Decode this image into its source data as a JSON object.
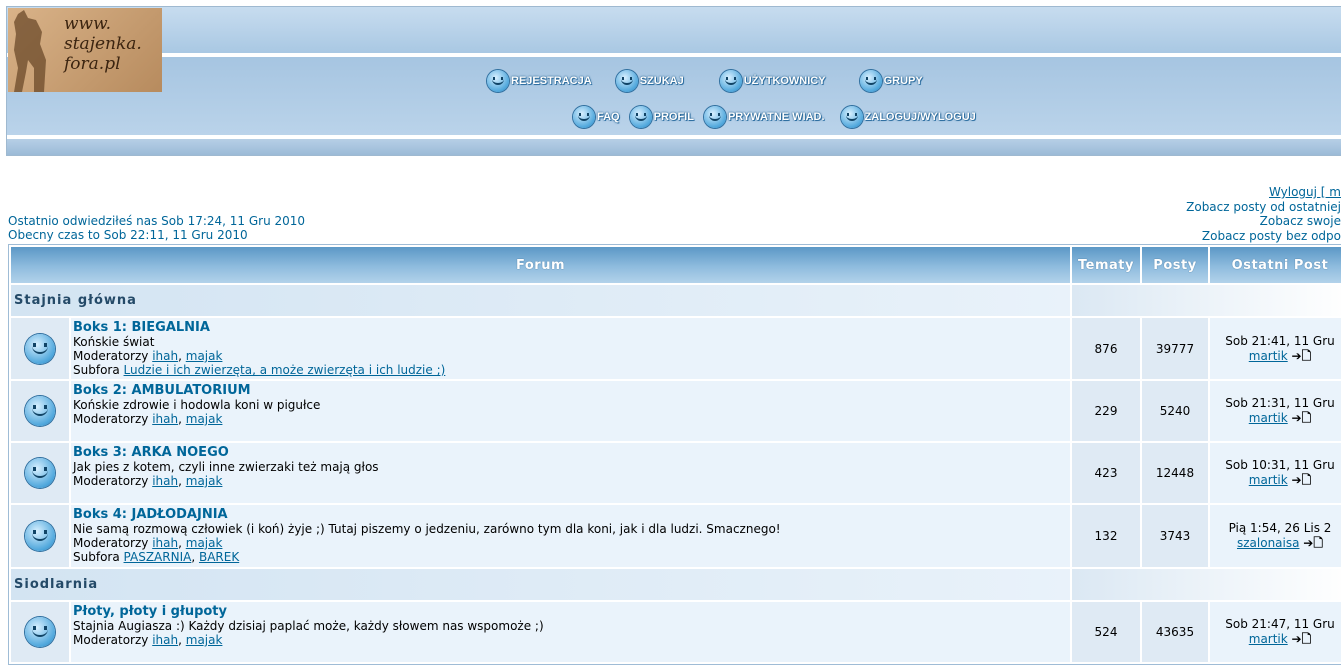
{
  "logo": {
    "line1": "www.",
    "line2": "stajenka.",
    "line3": "fora.pl"
  },
  "nav": {
    "row1": [
      "REJESTRACJA",
      "SZUKAJ",
      "UŻYTKOWNICY",
      "GRUPY"
    ],
    "row2": [
      "FAQ",
      "PROFIL",
      "PRYWATNE WIAD.",
      "ZALOGUJ/WYLOGUJ"
    ]
  },
  "info": {
    "last_visit": "Ostatnio odwiedziłeś nas Sob 17:24, 11 Gru 2010",
    "current_time": "Obecny czas to Sob 22:11, 11 Gru 2010"
  },
  "right_links": [
    "Wyloguj [ m",
    "Zobacz posty od ostatniej",
    "Zobacz swoje",
    "Zobacz posty bez odpo"
  ],
  "table": {
    "headers": {
      "forum": "Forum",
      "topics": "Tematy",
      "posts": "Posty",
      "last_post": "Ostatni Post"
    }
  },
  "categories": [
    {
      "name": "Stajnia główna",
      "forums": [
        {
          "title": "Boks 1: BIEGALNIA",
          "description": "Końskie świat",
          "mods_label": "Moderatorzy",
          "mods": [
            "ihah",
            "majak"
          ],
          "sub_label": "Subfora",
          "subforums": [
            "Ludzie i ich zwierzęta, a może zwierzęta i ich ludzie ;)"
          ],
          "topics": "876",
          "posts": "39777",
          "last_date": "Sob 21:41, 11 Gru",
          "last_user": "martik"
        },
        {
          "title": "Boks 2: AMBULATORIUM",
          "description": "Końskie zdrowie i hodowla koni w pigułce",
          "mods_label": "Moderatorzy",
          "mods": [
            "ihah",
            "majak"
          ],
          "topics": "229",
          "posts": "5240",
          "last_date": "Sob 21:31, 11 Gru",
          "last_user": "martik"
        },
        {
          "title": "Boks 3: ARKA NOEGO",
          "description": "Jak pies z kotem, czyli inne zwierzaki też mają głos",
          "mods_label": "Moderatorzy",
          "mods": [
            "ihah",
            "majak"
          ],
          "topics": "423",
          "posts": "12448",
          "last_date": "Sob 10:31, 11 Gru",
          "last_user": "martik"
        },
        {
          "title": "Boks 4: JADŁODAJNIA",
          "description": "Nie samą rozmową człowiek (i koń) żyje ;) Tutaj piszemy o jedzeniu, zarówno tym dla koni, jak i dla ludzi. Smacznego!",
          "mods_label": "Moderatorzy",
          "mods": [
            "ihah",
            "majak"
          ],
          "sub_label": "Subfora",
          "subforums": [
            "PASZARNIA",
            "BAREK"
          ],
          "topics": "132",
          "posts": "3743",
          "last_date": "Pią 1:54, 26 Lis 2",
          "last_user": "szalonaisa"
        }
      ]
    },
    {
      "name": "Siodlarnia",
      "forums": [
        {
          "title": "Płoty, płoty i głupoty",
          "description": "Stajnia Augiasza :) Każdy dzisiaj paplać może, każdy słowem nas wspomoże ;)",
          "mods_label": "Moderatorzy",
          "mods": [
            "ihah",
            "majak"
          ],
          "topics": "524",
          "posts": "43635",
          "last_date": "Sob 21:47, 11 Gru",
          "last_user": "martik"
        }
      ]
    }
  ],
  "icons": {
    "forum_icon": "smiley-face-icon",
    "goto_icon": "arrow-page-icon"
  },
  "colors": {
    "link": "#006699",
    "header_bar": "#5c98c6",
    "row_bg": "#eaf3fb"
  }
}
